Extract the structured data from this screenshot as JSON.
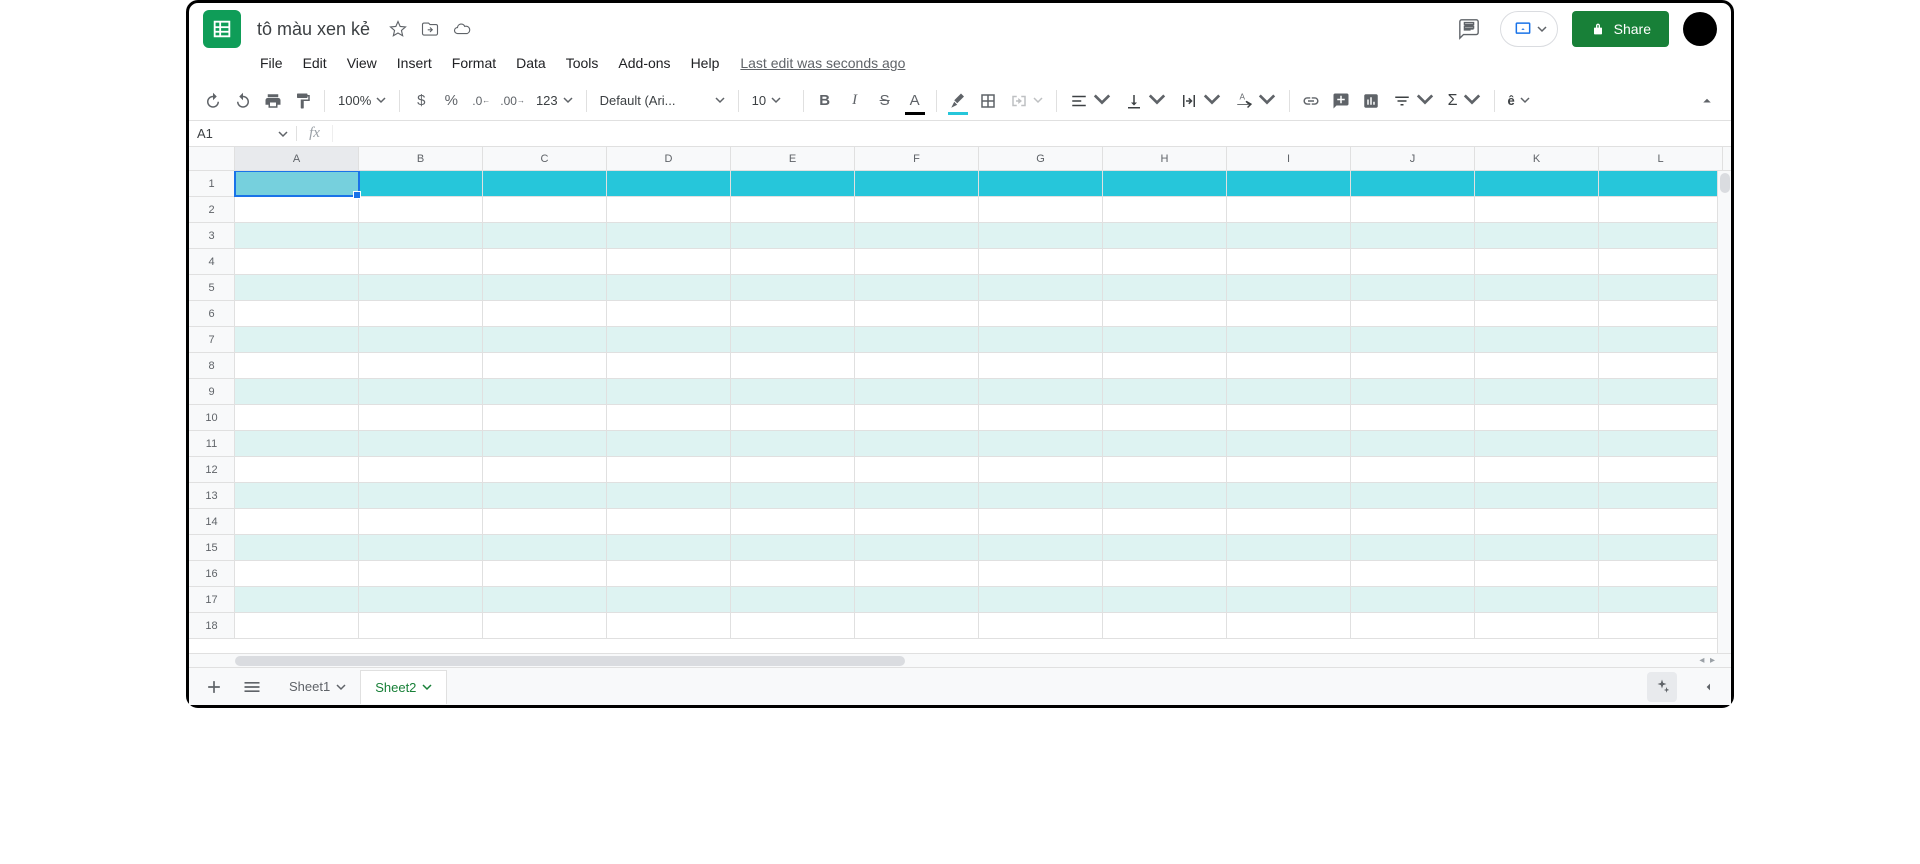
{
  "doc_title": "tô màu xen kẻ",
  "menus": [
    "File",
    "Edit",
    "View",
    "Insert",
    "Format",
    "Data",
    "Tools",
    "Add-ons",
    "Help"
  ],
  "last_edit": "Last edit was seconds ago",
  "toolbar": {
    "zoom": "100%",
    "number_format": "123",
    "font": "Default (Ari...",
    "font_size": "10",
    "share_label": "Share",
    "accent_char": "ê"
  },
  "name_box": "A1",
  "formula": "",
  "columns": [
    "A",
    "B",
    "C",
    "D",
    "E",
    "F",
    "G",
    "H",
    "I",
    "J",
    "K",
    "L"
  ],
  "rows": [
    1,
    2,
    3,
    4,
    5,
    6,
    7,
    8,
    9,
    10,
    11,
    12,
    13,
    14,
    15,
    16,
    17,
    18
  ],
  "active_cell": "A1",
  "sheets": [
    {
      "name": "Sheet1",
      "active": false
    },
    {
      "name": "Sheet2",
      "active": true
    }
  ],
  "colors": {
    "header_row": "#26c6da",
    "alt_row": "#def3f2"
  }
}
